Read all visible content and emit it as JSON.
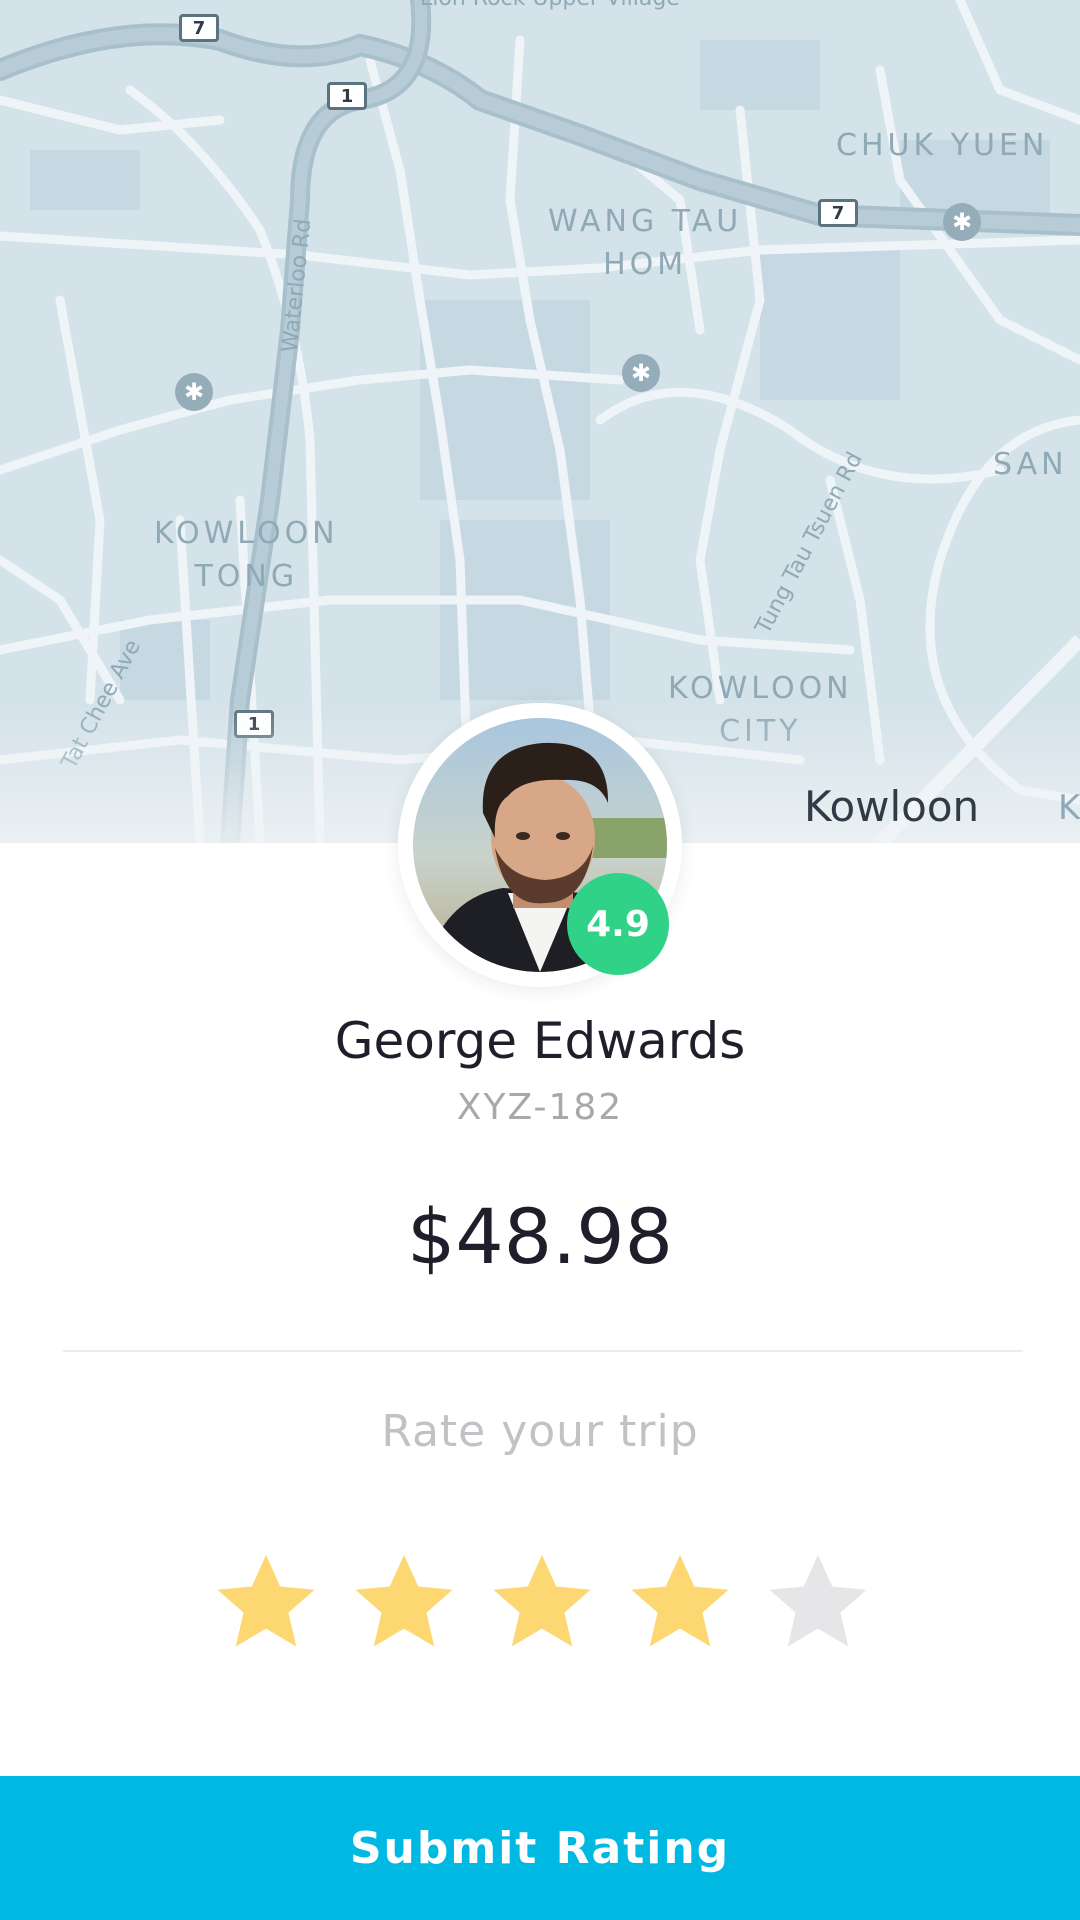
{
  "map": {
    "district_labels": [
      {
        "id": "chuk-yuen",
        "text": "CHUK YUEN"
      },
      {
        "id": "wang-tau-hom",
        "text": "WANG TAU\nHOM"
      },
      {
        "id": "kowloon-tong",
        "text": "KOWLOON\nTONG"
      },
      {
        "id": "kowloon-city",
        "text": "KOWLOON\nCITY"
      },
      {
        "id": "san",
        "text": "SAN"
      }
    ],
    "road_labels": [
      {
        "id": "waterloo",
        "text": "Waterloo Rd"
      },
      {
        "id": "tung-tau",
        "text": "Tung Tau Tsuen Rd"
      },
      {
        "id": "tat-chee",
        "text": "Tat Chee Ave"
      },
      {
        "id": "lion-rock",
        "text": "Lion Rock Upper Village"
      }
    ],
    "route_shields": [
      "7",
      "1",
      "7",
      "1"
    ],
    "region_label": "Kowloon",
    "edge_label": "K",
    "mtr_symbol": "✱"
  },
  "driver": {
    "name": "George Edwards",
    "plate": "XYZ-182",
    "rating": "4.9",
    "avatar_icon": "driver-photo"
  },
  "trip": {
    "price": "$48.98",
    "rate_prompt": "Rate your trip"
  },
  "rating_input": {
    "max_stars": 5,
    "selected": 4,
    "filled_color": "#fcd772",
    "empty_color": "#e6e6e8"
  },
  "colors": {
    "accent": "#00b9e2",
    "badge": "#2fd287"
  },
  "submit": {
    "label": "Submit Rating"
  }
}
